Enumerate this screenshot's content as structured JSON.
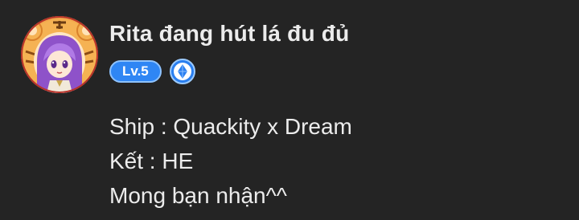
{
  "comment": {
    "author": {
      "name": "Rita đang hút lá đu đủ",
      "level_label": "Lv.5",
      "avatar_icon": "tiger-hood-girl-avatar",
      "rank_icon": "diamond-rank-icon"
    },
    "lines": [
      "Ship : Quackity x Dream",
      "Kết : HE",
      "Mong bạn nhận^^"
    ]
  },
  "colors": {
    "background": "#242424",
    "text": "#ececec",
    "level_badge": "#2f86f4",
    "rank_badge": "#2a7ff0"
  }
}
